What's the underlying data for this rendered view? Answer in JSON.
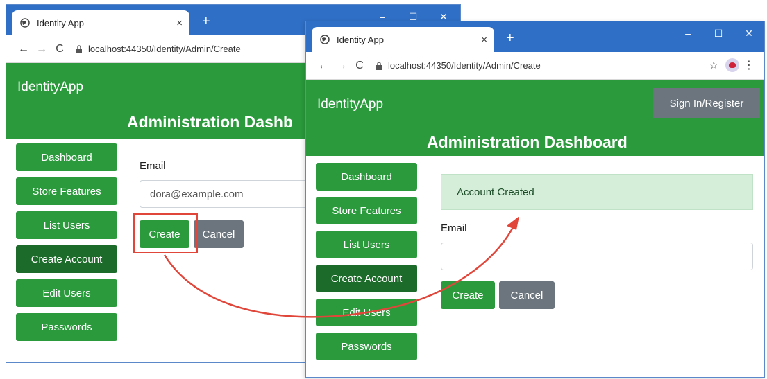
{
  "colors": {
    "brand_green": "#2a9a3c",
    "active_green": "#1c6b2a",
    "secondary_gray": "#6c757d",
    "titlebar_blue": "#2f6fc5",
    "alert_bg": "#d4eed9",
    "highlight_red": "#e0463a"
  },
  "window1": {
    "tab_title": "Identity App",
    "tab_close": "×",
    "new_tab": "+",
    "controls": {
      "minimize": "–",
      "maximize": "☐",
      "close": "✕"
    },
    "nav": {
      "back": "←",
      "forward": "→",
      "reload": "C"
    },
    "url": "localhost:44350/Identity/Admin/Create",
    "brand": "IdentityApp",
    "title": "Administration Dashb",
    "sidebar": [
      "Dashboard",
      "Store Features",
      "List Users",
      "Create Account",
      "Edit Users",
      "Passwords"
    ],
    "active_index": 3,
    "form": {
      "email_label": "Email",
      "email_value": "dora@example.com",
      "create": "Create",
      "cancel": "Cancel"
    }
  },
  "window2": {
    "tab_title": "Identity App",
    "tab_close": "×",
    "new_tab": "+",
    "controls": {
      "minimize": "–",
      "maximize": "☐",
      "close": "✕"
    },
    "nav": {
      "back": "←",
      "forward": "→",
      "reload": "C"
    },
    "url": "localhost:44350/Identity/Admin/Create",
    "star": "☆",
    "kebab": "⋮",
    "brand": "IdentityApp",
    "signin": "Sign In/Register",
    "title": "Administration Dashboard",
    "sidebar": [
      "Dashboard",
      "Store Features",
      "List Users",
      "Create Account",
      "Edit Users",
      "Passwords"
    ],
    "active_index": 3,
    "alert": "Account Created",
    "form": {
      "email_label": "Email",
      "email_value": "",
      "create": "Create",
      "cancel": "Cancel"
    }
  }
}
